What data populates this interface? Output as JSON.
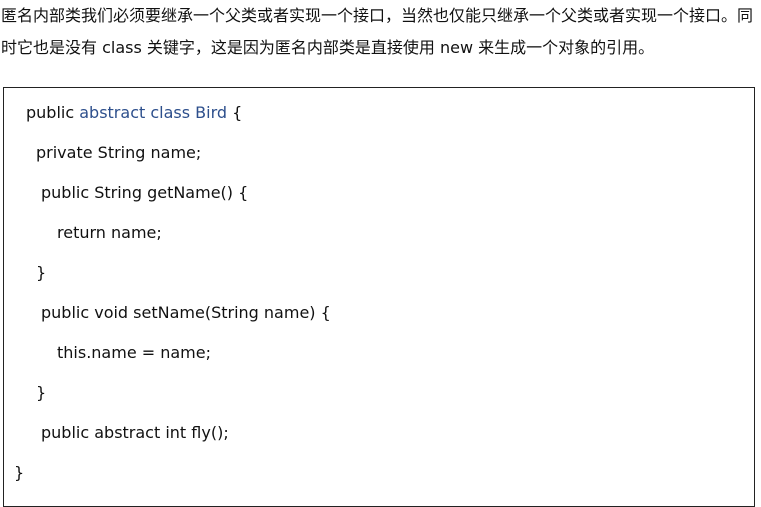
{
  "intro": {
    "text": "匿名内部类我们必须要继承一个父类或者实现一个接口，当然也仅能只继承一个父类或者实现一个接口。同时它也是没有 class 关键字，这是因为匿名内部类是直接使用 new 来生成一个对象的引用。"
  },
  "code": {
    "line1_prefix": "public ",
    "line1_highlight": "abstract class Bird",
    "line1_suffix": " {",
    "line2": "private String name;",
    "line3": "public String getName() {",
    "line4": "return name;",
    "line5": "}",
    "line6": "public void setName(String name) {",
    "line7": "this.name = name;",
    "line8": "}",
    "line9": "public abstract int fly();",
    "line10": "}"
  },
  "colors": {
    "highlight": "#2d4f8c",
    "border": "#222222",
    "text": "#111111"
  }
}
